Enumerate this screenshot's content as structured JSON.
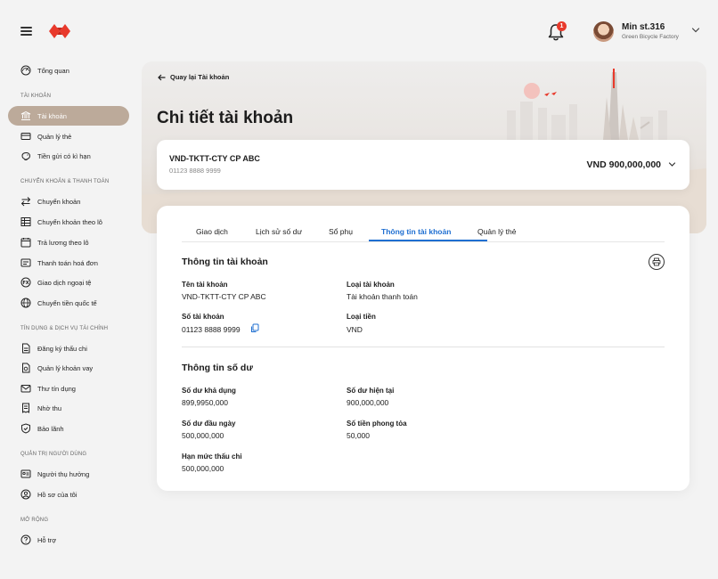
{
  "header": {
    "notification_count": "1",
    "user_name": "Min st.316",
    "user_company": "Green Bicycle Factory",
    "brand_color": "#e8392b"
  },
  "sidebar": {
    "overview": "Tổng quan",
    "sections": [
      {
        "title": "TÀI KHOẢN",
        "items": [
          "Tài khoản",
          "Quản lý thẻ",
          "Tiền gửi có kì hạn"
        ]
      },
      {
        "title": "CHUYỂN KHOẢN & THANH TOÁN",
        "items": [
          "Chuyển khoản",
          "Chuyển khoản theo lô",
          "Trả lương theo lô",
          "Thanh toán hoá đơn",
          "Giao dịch ngoại tệ",
          "Chuyển tiền quốc tế"
        ]
      },
      {
        "title": "TÍN DỤNG & DỊCH VỤ TÀI CHÍNH",
        "items": [
          "Đăng ký thấu chi",
          "Quản lý khoản vay",
          "Thư tín dụng",
          "Nhờ thu",
          "Bảo lãnh"
        ]
      },
      {
        "title": "QUẢN TRỊ NGƯỜI DÙNG",
        "items": [
          "Người thụ hưởng",
          "Hồ sơ của tôi"
        ]
      },
      {
        "title": "MỞ RỘNG",
        "items": [
          "Hỗ trợ"
        ]
      }
    ],
    "active_item": "Tài khoản",
    "active_color": "#bcaa9a"
  },
  "page": {
    "back_label": "Quay lại Tài khoản",
    "title": "Chi tiết tài khoản"
  },
  "account": {
    "name": "VND-TKTT-CTY CP ABC",
    "number": "01123 8888 9999",
    "balance": "VND 900,000,000"
  },
  "tabs": [
    "Giao dịch",
    "Lịch sử số dư",
    "Sổ phụ",
    "Thông tin tài khoản",
    "Quản lý thẻ"
  ],
  "active_tab": "Thông tin tài khoản",
  "accent_color": "#1f6fd1",
  "account_info": {
    "title": "Thông tin tài khoản",
    "fields": [
      {
        "label": "Tên tài khoản",
        "value": "VND-TKTT-CTY CP ABC"
      },
      {
        "label": "Loại tài khoản",
        "value": "Tài khoản thanh toán"
      },
      {
        "label": "Số tài khoản",
        "value": "01123 8888 9999"
      },
      {
        "label": "Loại tiền",
        "value": "VND"
      }
    ]
  },
  "balance_info": {
    "title": "Thông tin số dư",
    "fields": [
      {
        "label": "Số dư khả dụng",
        "value": "899,9950,000"
      },
      {
        "label": "Số dư hiện tại",
        "value": "900,000,000"
      },
      {
        "label": "Số dư đầu ngày",
        "value": "500,000,000"
      },
      {
        "label": "Số tiền phong tỏa",
        "value": "50,000"
      },
      {
        "label": "Hạn mức thấu chi",
        "value": "500,000,000"
      }
    ]
  }
}
